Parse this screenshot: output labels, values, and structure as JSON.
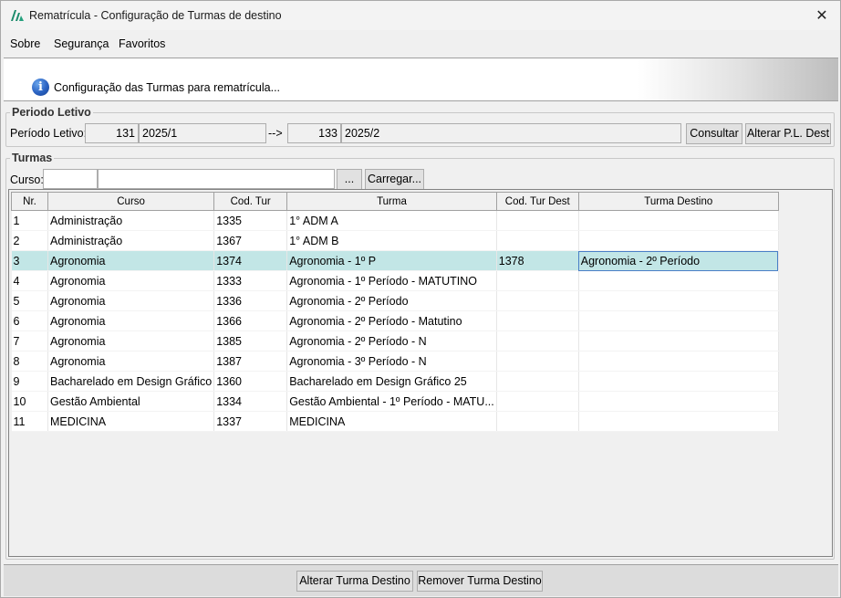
{
  "window": {
    "title": "Rematrícula - Configuração de Turmas de destino",
    "close_symbol": "✕"
  },
  "menu": {
    "items": [
      "Sobre",
      "Segurança",
      "Favoritos"
    ]
  },
  "banner": {
    "text": "Configuração das Turmas para rematrícula..."
  },
  "periodo": {
    "group_title": "Periodo Letivo",
    "label": "Período Letivo:",
    "origem_codigo": "131",
    "origem_descricao": "2025/1",
    "arrow": "-->",
    "destino_codigo": "133",
    "destino_descricao": "2025/2",
    "consultar_label": "Consultar",
    "alterar_label": "Alterar P.L. Dest"
  },
  "turmas": {
    "group_title": "Turmas",
    "curso_label": "Curso:",
    "curso_code": "",
    "curso_name": "",
    "ellipsis_label": "...",
    "carregar_label": "Carregar...",
    "columns": [
      "Nr.",
      "Curso",
      "Cod. Tur",
      "Turma",
      "Cod. Tur Dest",
      "Turma Destino"
    ],
    "rows": [
      [
        "1",
        "Administração",
        "1335",
        "1° ADM A",
        "",
        ""
      ],
      [
        "2",
        "Administração",
        "1367",
        "1° ADM B",
        "",
        ""
      ],
      [
        "3",
        "Agronomia",
        "1374",
        "Agronomia - 1º P",
        "1378",
        "Agronomia - 2º Período"
      ],
      [
        "4",
        "Agronomia",
        "1333",
        "Agronomia - 1º Período - MATUTINO",
        "",
        ""
      ],
      [
        "5",
        "Agronomia",
        "1336",
        "Agronomia - 2º Período",
        "",
        ""
      ],
      [
        "6",
        "Agronomia",
        "1366",
        "Agronomia - 2º Período - Matutino",
        "",
        ""
      ],
      [
        "7",
        "Agronomia",
        "1385",
        "Agronomia - 2º Período - N",
        "",
        ""
      ],
      [
        "8",
        "Agronomia",
        "1387",
        "Agronomia - 3º Período - N",
        "",
        ""
      ],
      [
        "9",
        "Bacharelado em Design Gráfico",
        "1360",
        "Bacharelado em Design Gráfico 25",
        "",
        ""
      ],
      [
        "10",
        "Gestão Ambiental",
        "1334",
        "Gestão Ambiental - 1º Período - MATU...",
        "",
        ""
      ],
      [
        "11",
        "MEDICINA",
        "1337",
        "MEDICINA",
        "",
        ""
      ]
    ],
    "selected_row": 2
  },
  "footer": {
    "alterar_label": "Alterar Turma Destino",
    "remover_label": "Remover Turma Destino"
  },
  "colors": {
    "selected_row": "#c2e6e6",
    "app_icon": "#1a8a6a",
    "info_icon": "#2a62c2"
  }
}
